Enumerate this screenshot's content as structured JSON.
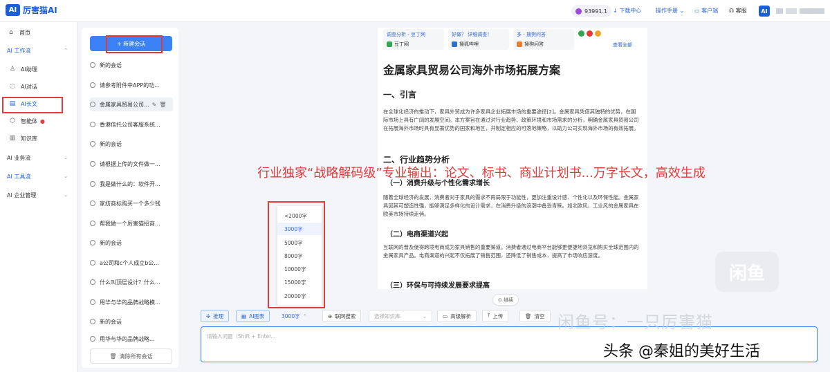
{
  "app": {
    "logo_badge": "AI",
    "name": "厉害猫AI"
  },
  "topbar": {
    "credits": "93991.1",
    "download": "↓ 下载中心",
    "manual": "操作手册 ⌄",
    "client": "客户端",
    "service": "客服",
    "avatar": "AI"
  },
  "nav": {
    "home": "首页",
    "ai_workflow": "AI 工作流",
    "assistant": "AI助理",
    "chat": "AI对话",
    "longtext": "AI长文",
    "agent": "智能体",
    "knowledge": "知识库",
    "ai_business": "AI 业务流",
    "ai_tools": "AI 工具流",
    "ai_enterprise": "AI 企业管理"
  },
  "conversations": {
    "new_label": "+ 新建会话",
    "clear_label": "清除所有会话",
    "items": [
      "新的会话",
      "请参考附件中APP的功...",
      "金属家具贸易公司...",
      "香港信托公司客服系统...",
      "新的会话",
      "请根据上传的文件做一...",
      "我是做什么的：软件开...",
      "家纺商标购买一个多少钱",
      "帮我做一个厉害猫招商...",
      "新的会话",
      "a公司和c个人成立b公...",
      "什么叫顶层设计？什么...",
      "用华与华的品牌战略模...",
      "新的会话",
      "用华与华的品牌战略..."
    ]
  },
  "sources": [
    {
      "title": "调查分析 - 豆丁网",
      "site": "豆丁网",
      "color": "#2fa84f"
    },
    {
      "title": "好做？ 详细调查！",
      "site": "搜狐哔哩",
      "color": "#2d6fd6"
    },
    {
      "title": "多 - 搜狗问答",
      "site": "搜狗问答",
      "color": "#f07b2a"
    }
  ],
  "sources_more": "查看全部",
  "document": {
    "title": "金属家具贸易公司海外市场拓展方案",
    "h_intro": "一、引言",
    "p_intro": "在全球化经济的推动下，家具外贸成为许多家具企业拓展市场的重要途径[2]。金属家具凭借其独特的优势，在国际市场上具有广阔的发展空间。本方案旨在通过对行业趋势、政策环境和市场需求的分析，明确金属家具贸易公司在拓展海外市场时具有显著优势的国家和地区，并制定相应的可落地策略，以助力公司实现海外市场的有效拓展。",
    "h_trend": "二、行业趋势分析",
    "h_trend1": "（一）消费升级与个性化需求增长",
    "p_trend1": "随着全球经济的发展，消费者对于家具的需求不再局限于功能性，更加注重设计感、个性化以及环保性能。金属家具因其可塑造性强，能够满足多样化的设计需求，在消费升级的浪潮中备受青睐。如北欧风、工业风的金属家具在欧美市场持续走俏。",
    "h_trend2": "（二）电商渠道兴起",
    "p_trend2": "互联网的普及使得跨境电商成为家具销售的重要渠道。消费者通过电商平台能够更便捷地浏览和购买全球范围内的金属家具产品。电商渠道的兴起不仅拓展了销售范围，还降低了销售成本，提高了市场响应速度。",
    "h_trend3": "（三）环保与可持续发展要求提高"
  },
  "overlay_caption": "行业独家“战略解码级”专业输出：论文、标书、商业计划书...万字长文，高效生成",
  "continue_label": "⊙ 继续",
  "wordcount_options": [
    "<2000字",
    "3000字",
    "5000字",
    "8000字",
    "10000字",
    "15000字",
    "20000字"
  ],
  "toolbar": {
    "reason": "推理",
    "chart": "AI图表",
    "wordcount": "3000字",
    "web": "联网搜索",
    "kb_placeholder": "选择知识库",
    "advanced": "高级解析",
    "upload": "上传",
    "clear": "清空"
  },
  "input_placeholder": "请输入问题（Shift + Enter...",
  "watermarks": {
    "app_icon": "闲鱼",
    "seller": "闲鱼号：一只厉害猫",
    "toutiao": "头条 @秦姐的美好生活"
  }
}
